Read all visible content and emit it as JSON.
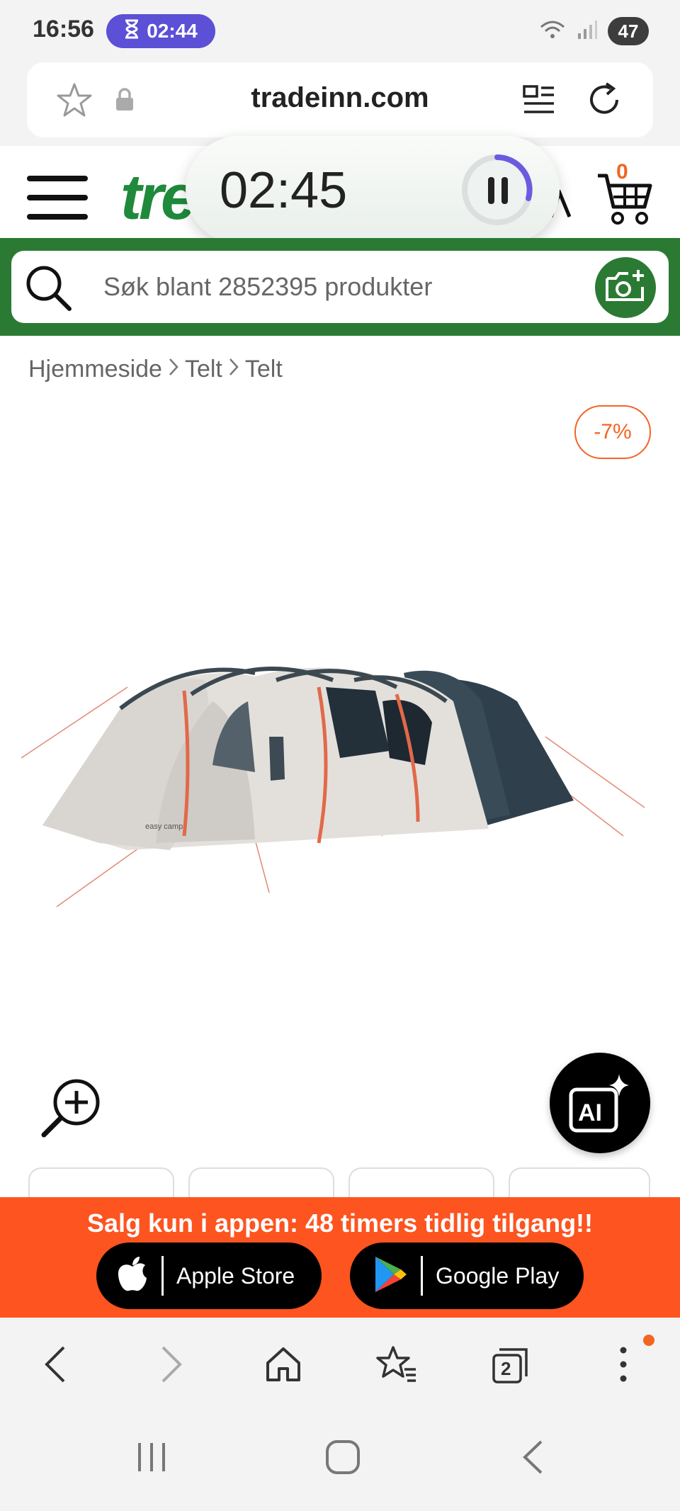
{
  "status_bar": {
    "time": "16:56",
    "timer": "02:44",
    "battery": "47",
    "icons": [
      "hourglass-icon",
      "wifi-icon",
      "signal-icon",
      "battery-icon"
    ]
  },
  "browser": {
    "url": "tradeinn.com",
    "icons": [
      "star-icon",
      "lock-icon",
      "reader-mode-icon",
      "reload-icon"
    ]
  },
  "site_header": {
    "logo": "tre",
    "cart_count": "0"
  },
  "floating_timer": {
    "time": "02:45",
    "progress": 0.3
  },
  "search": {
    "placeholder": "Søk blant 2852395 produkter"
  },
  "breadcrumb": [
    "Hjemmeside",
    "Telt",
    "Telt"
  ],
  "product": {
    "discount": "-7%",
    "image_brand": "easy camp"
  },
  "ai_button": {
    "label": "AI"
  },
  "promo": {
    "text": "Salg kun i appen: 48 timers tidlig tilgang!!",
    "apple_label": "Apple Store",
    "google_label": "Google Play"
  },
  "toolbar": {
    "tab_count": "2",
    "icons": [
      "back-icon",
      "forward-icon",
      "home-icon",
      "bookmarks-icon",
      "tabs-icon",
      "more-icon"
    ]
  },
  "colors": {
    "brand_green": "#2b7a34",
    "accent_orange": "#f26522",
    "promo_orange": "#fd5420",
    "timer_purple": "#5b50d6"
  }
}
